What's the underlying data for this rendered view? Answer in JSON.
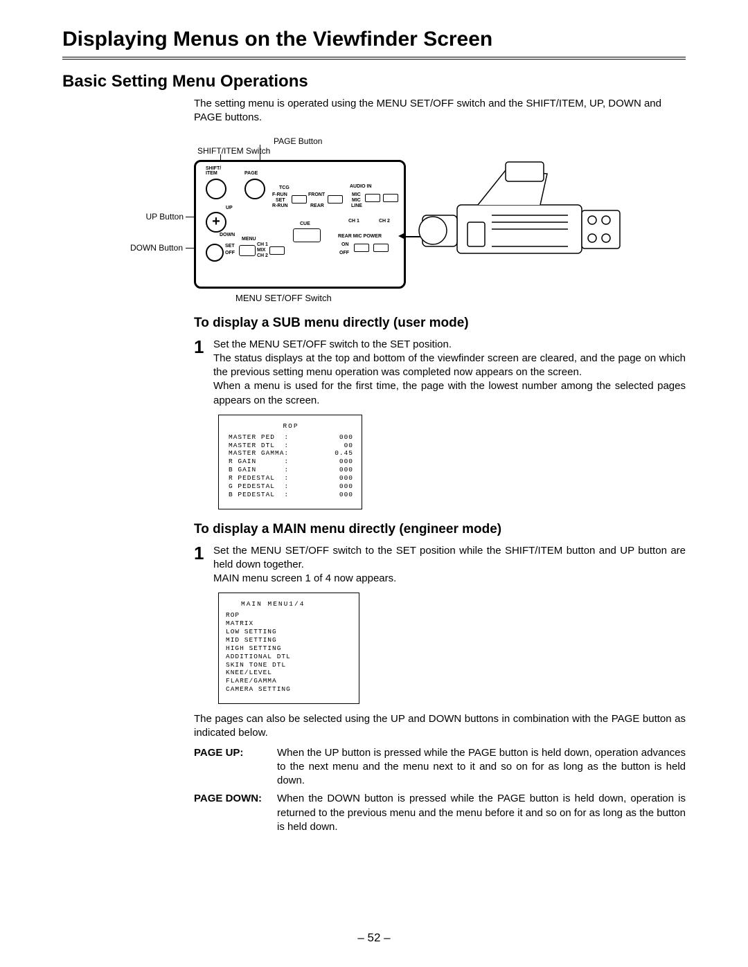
{
  "page_title": "Displaying Menus on the Viewfinder Screen",
  "section_title": "Basic Setting Menu Operations",
  "intro": "The setting menu is operated using the MENU SET/OFF switch and the SHIFT/ITEM, UP, DOWN and PAGE buttons.",
  "callouts": {
    "page_button": "PAGE Button",
    "shift_item_switch": "SHIFT/ITEM Switch",
    "up_button": "UP Button",
    "down_button": "DOWN Button",
    "menu_set_off": "MENU SET/OFF Switch"
  },
  "panel_labels": {
    "shift_item": "SHIFT/\nITEM",
    "page": "PAGE",
    "up": "UP",
    "down": "DOWN",
    "menu": "MENU",
    "set": "SET",
    "off": "OFF",
    "mix": "MIX",
    "ch1": "CH 1",
    "ch2": "CH 2",
    "tcg": "TCG",
    "frun": "F-RUN",
    "rrun": "R-RUN",
    "set2": "SET",
    "front": "FRONT",
    "rear": "REAR",
    "cue": "CUE",
    "audio_in": "AUDIO IN",
    "mic": "MIC",
    "mic2": "MIC",
    "line": "LINE",
    "ch1b": "CH 1",
    "ch2b": "CH 2",
    "rear_mic_power": "REAR MIC POWER",
    "on": "ON",
    "off2": "OFF"
  },
  "sub_heading": "To display a SUB menu directly (user mode)",
  "step1_text": "Set the MENU SET/OFF switch to the SET position.\nThe status displays at the top and bottom of the viewfinder screen are cleared, and the page on which the previous setting menu operation was completed now appears on the screen.\nWhen a menu is used for the first time, the page with the lowest number among the selected pages appears on the screen.",
  "rop_screen": {
    "title": "ROP",
    "rows": [
      {
        "k": "MASTER PED",
        "v": "000"
      },
      {
        "k": "MASTER DTL",
        "v": "00"
      },
      {
        "k": "MASTER GAMMA",
        "v": "0.45"
      },
      {
        "k": "R GAIN",
        "v": "000"
      },
      {
        "k": "B GAIN",
        "v": "000"
      },
      {
        "k": "R PEDESTAL",
        "v": "000"
      },
      {
        "k": "G PEDESTAL",
        "v": "000"
      },
      {
        "k": "B PEDESTAL",
        "v": "000"
      }
    ]
  },
  "main_heading": "To display a MAIN menu directly (engineer mode)",
  "main_step_text": "Set the MENU SET/OFF switch to the SET position while the SHIFT/ITEM button and UP button are held down together.\nMAIN menu screen 1 of 4 now appears.",
  "main_screen": {
    "title": "MAIN MENU1/4",
    "items": [
      "ROP",
      "MATRIX",
      "LOW SETTING",
      "MID SETTING",
      "HIGH SETTING",
      "ADDITIONAL DTL",
      "SKIN TONE DTL",
      "KNEE/LEVEL",
      "FLARE/GAMMA",
      "CAMERA SETTING"
    ]
  },
  "after_screen": "The pages can also be selected using the UP and DOWN buttons in combination with the PAGE button as indicated below.",
  "defs": [
    {
      "k": "PAGE  UP:",
      "v": "When the UP button is pressed while the PAGE button is held down, operation advances to the next menu and the menu next to it and so on for as long as the button is held down."
    },
    {
      "k": "PAGE  DOWN:",
      "v": "When the DOWN button is pressed while the PAGE button is held down, operation is returned to the previous menu and the menu before it and so on for as long as the button is held down."
    }
  ],
  "page_number": "– 52 –"
}
